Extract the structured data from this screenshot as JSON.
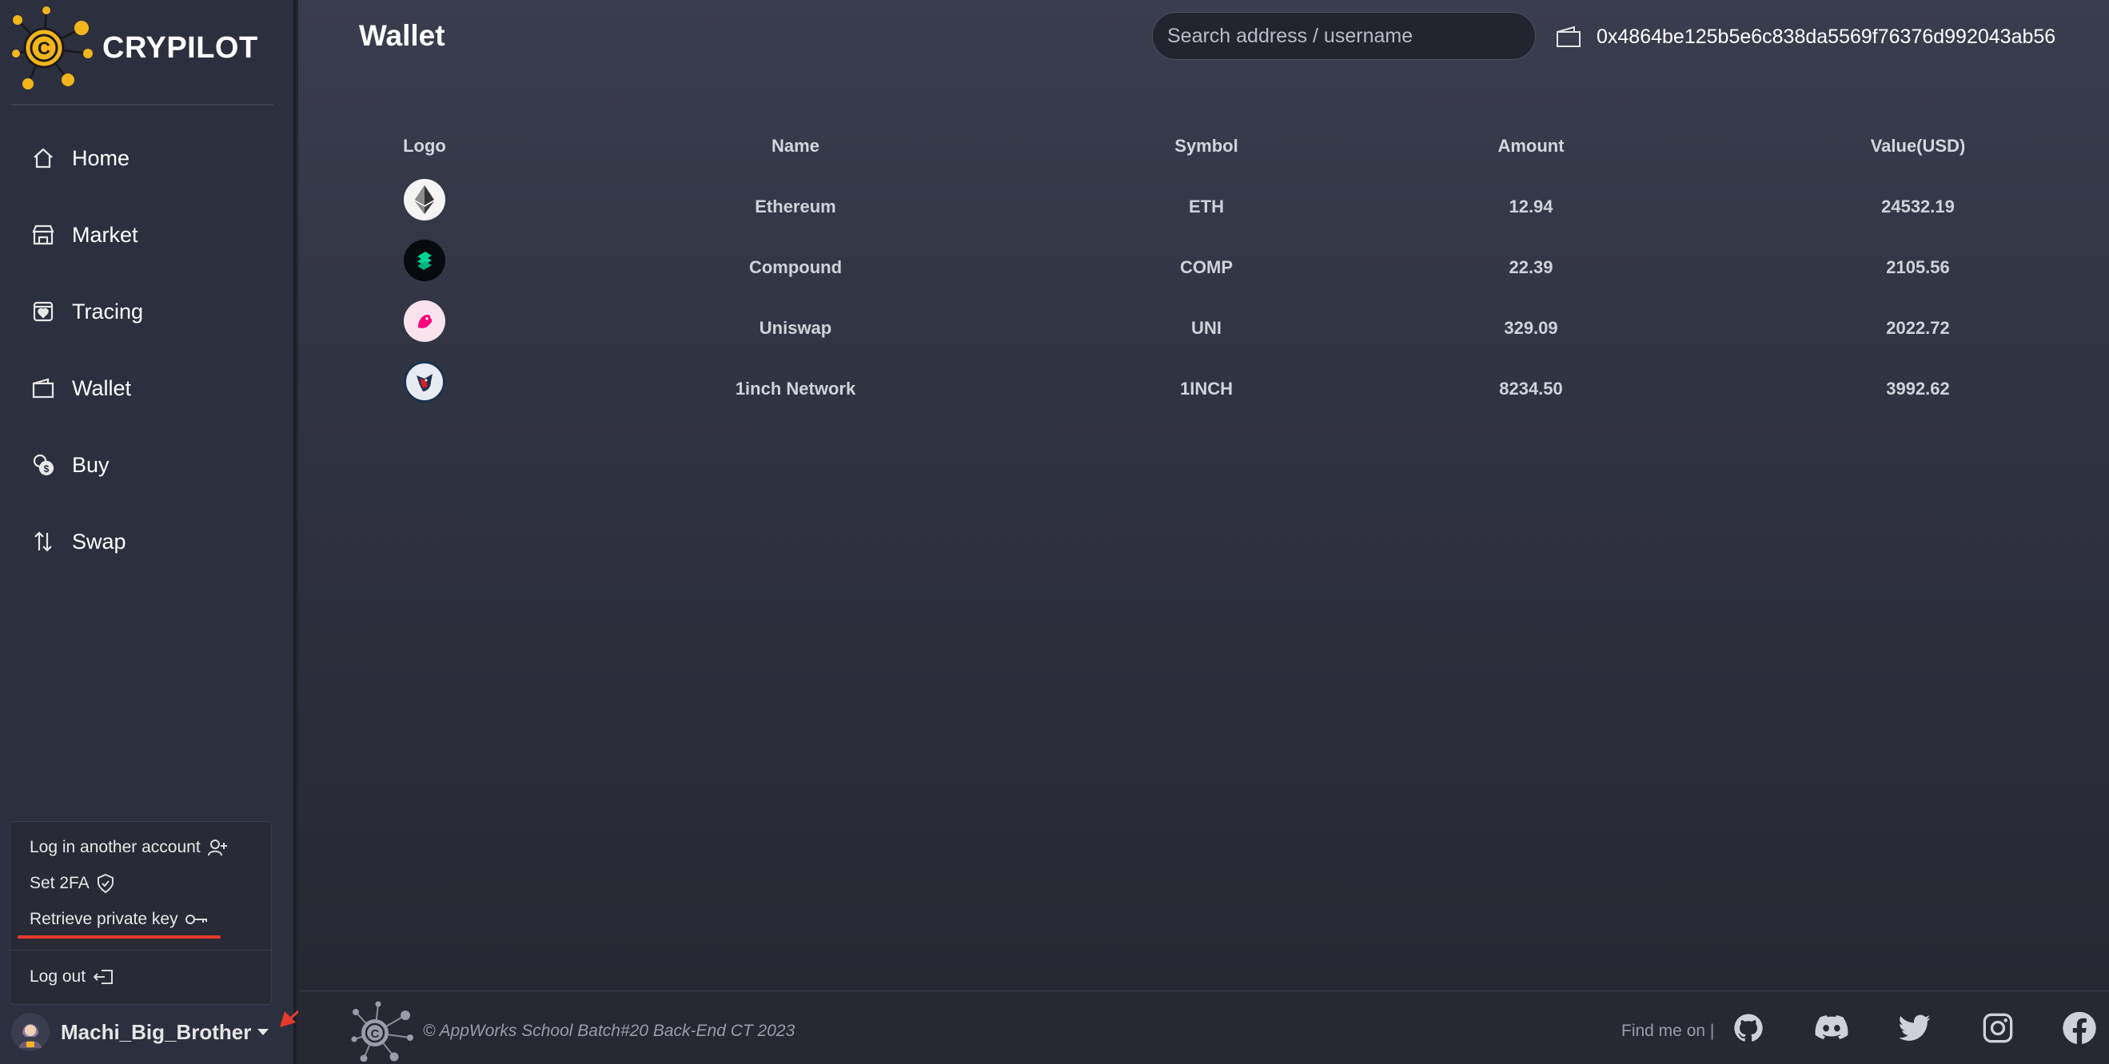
{
  "brand": {
    "name": "CRYPILOT"
  },
  "nav": [
    {
      "label": "Home",
      "icon": "home-icon"
    },
    {
      "label": "Market",
      "icon": "store-icon"
    },
    {
      "label": "Tracing",
      "icon": "heart-box-icon"
    },
    {
      "label": "Wallet",
      "icon": "wallet-icon"
    },
    {
      "label": "Buy",
      "icon": "coins-icon"
    },
    {
      "label": "Swap",
      "icon": "swap-icon"
    }
  ],
  "account_menu": {
    "login_another": "Log in another account",
    "set_2fa": "Set 2FA",
    "retrieve_key": "Retrieve private key",
    "logout": "Log out"
  },
  "user": {
    "name": "Machi_Big_Brother"
  },
  "header": {
    "title": "Wallet",
    "search_placeholder": "Search address / username",
    "wallet_address": "0x4864be125b5e6c838da5569f76376d992043ab56"
  },
  "table": {
    "columns": [
      "Logo",
      "Name",
      "Symbol",
      "Amount",
      "Value(USD)"
    ],
    "rows": [
      {
        "name": "Ethereum",
        "symbol": "ETH",
        "amount": "12.94",
        "value": "24532.19",
        "logo": "ethereum-logo"
      },
      {
        "name": "Compound",
        "symbol": "COMP",
        "amount": "22.39",
        "value": "2105.56",
        "logo": "compound-logo"
      },
      {
        "name": "Uniswap",
        "symbol": "UNI",
        "amount": "329.09",
        "value": "2022.72",
        "logo": "uniswap-logo"
      },
      {
        "name": "1inch Network",
        "symbol": "1INCH",
        "amount": "8234.50",
        "value": "3992.62",
        "logo": "1inch-logo"
      }
    ]
  },
  "footer": {
    "copyright": "© AppWorks School Batch#20 Back-End CT 2023",
    "find_me": "Find me on |",
    "social": [
      "github-icon",
      "discord-icon",
      "twitter-icon",
      "instagram-icon",
      "facebook-icon"
    ]
  },
  "colors": {
    "accent": "#f2b51c",
    "annotation": "#e53b2a",
    "sidebar": "#2c2f3d"
  }
}
